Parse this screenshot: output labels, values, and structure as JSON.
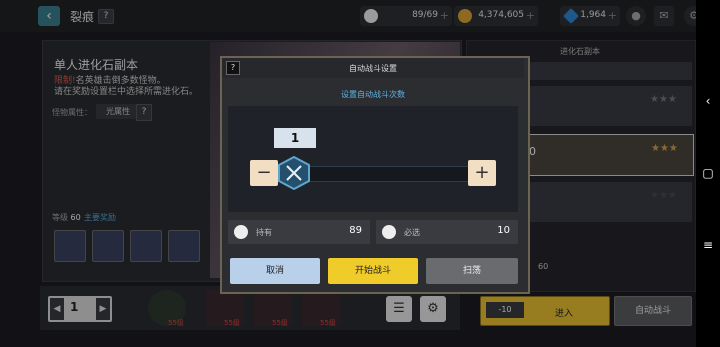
{
  "header": {
    "title": "裂痕",
    "help": "?",
    "stamina": "89/69",
    "gold": "4,374,605",
    "gems": "1,964"
  },
  "stage": {
    "title": "单人进化石副本",
    "desc_prefix": "限制!",
    "desc_line1": "名英雄击倒多数怪物。",
    "desc_line2": "请在奖励设置栏中选择所需进化石。",
    "attr_label": "怪物属性：",
    "attr_value": "光属性",
    "attr_help": "?",
    "level_label": "等级",
    "level_value": "60",
    "reward_label": "主要奖励"
  },
  "pager": {
    "page": "1"
  },
  "team": {
    "slot_level": "55级"
  },
  "right": {
    "header": "进化石副本",
    "selected_num": "0",
    "lvl": "60",
    "enter_cost": "-10",
    "enter_label": "进入",
    "auto_battle_label": "自动战斗"
  },
  "modal": {
    "help": "?",
    "title": "自动战斗设置",
    "subtitle": "设置自动战斗次数",
    "count": "1",
    "minus": "−",
    "plus": "+",
    "owned_label": "持有",
    "owned_value": "89",
    "required_label": "必选",
    "required_value": "10",
    "cancel_label": "取消",
    "start_label": "开始战斗",
    "sweep_label": "扫荡"
  },
  "colors": {
    "accent_yellow": "#f0cc2a",
    "accent_blue": "#5fb4e6",
    "cancel_blue": "#b8d0ea"
  }
}
